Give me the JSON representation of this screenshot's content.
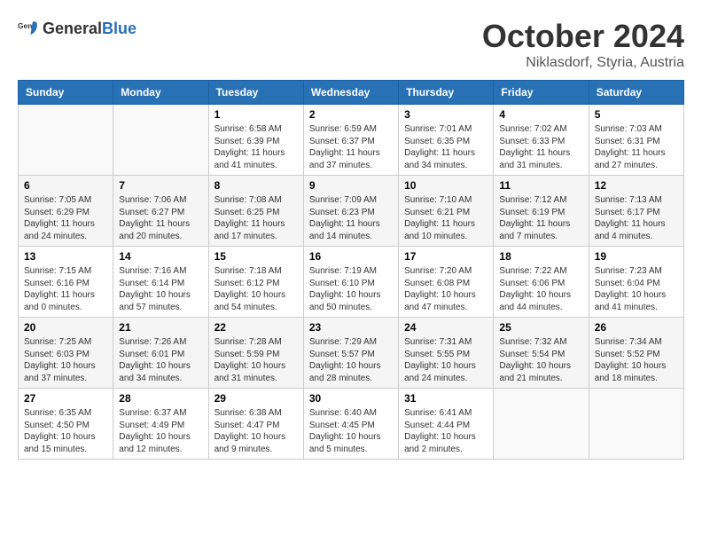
{
  "logo": {
    "text_general": "General",
    "text_blue": "Blue"
  },
  "header": {
    "month": "October 2024",
    "location": "Niklasdorf, Styria, Austria"
  },
  "weekdays": [
    "Sunday",
    "Monday",
    "Tuesday",
    "Wednesday",
    "Thursday",
    "Friday",
    "Saturday"
  ],
  "weeks": [
    [
      {
        "day": "",
        "info": ""
      },
      {
        "day": "",
        "info": ""
      },
      {
        "day": "1",
        "info": "Sunrise: 6:58 AM\nSunset: 6:39 PM\nDaylight: 11 hours\nand 41 minutes."
      },
      {
        "day": "2",
        "info": "Sunrise: 6:59 AM\nSunset: 6:37 PM\nDaylight: 11 hours\nand 37 minutes."
      },
      {
        "day": "3",
        "info": "Sunrise: 7:01 AM\nSunset: 6:35 PM\nDaylight: 11 hours\nand 34 minutes."
      },
      {
        "day": "4",
        "info": "Sunrise: 7:02 AM\nSunset: 6:33 PM\nDaylight: 11 hours\nand 31 minutes."
      },
      {
        "day": "5",
        "info": "Sunrise: 7:03 AM\nSunset: 6:31 PM\nDaylight: 11 hours\nand 27 minutes."
      }
    ],
    [
      {
        "day": "6",
        "info": "Sunrise: 7:05 AM\nSunset: 6:29 PM\nDaylight: 11 hours\nand 24 minutes."
      },
      {
        "day": "7",
        "info": "Sunrise: 7:06 AM\nSunset: 6:27 PM\nDaylight: 11 hours\nand 20 minutes."
      },
      {
        "day": "8",
        "info": "Sunrise: 7:08 AM\nSunset: 6:25 PM\nDaylight: 11 hours\nand 17 minutes."
      },
      {
        "day": "9",
        "info": "Sunrise: 7:09 AM\nSunset: 6:23 PM\nDaylight: 11 hours\nand 14 minutes."
      },
      {
        "day": "10",
        "info": "Sunrise: 7:10 AM\nSunset: 6:21 PM\nDaylight: 11 hours\nand 10 minutes."
      },
      {
        "day": "11",
        "info": "Sunrise: 7:12 AM\nSunset: 6:19 PM\nDaylight: 11 hours\nand 7 minutes."
      },
      {
        "day": "12",
        "info": "Sunrise: 7:13 AM\nSunset: 6:17 PM\nDaylight: 11 hours\nand 4 minutes."
      }
    ],
    [
      {
        "day": "13",
        "info": "Sunrise: 7:15 AM\nSunset: 6:16 PM\nDaylight: 11 hours\nand 0 minutes."
      },
      {
        "day": "14",
        "info": "Sunrise: 7:16 AM\nSunset: 6:14 PM\nDaylight: 10 hours\nand 57 minutes."
      },
      {
        "day": "15",
        "info": "Sunrise: 7:18 AM\nSunset: 6:12 PM\nDaylight: 10 hours\nand 54 minutes."
      },
      {
        "day": "16",
        "info": "Sunrise: 7:19 AM\nSunset: 6:10 PM\nDaylight: 10 hours\nand 50 minutes."
      },
      {
        "day": "17",
        "info": "Sunrise: 7:20 AM\nSunset: 6:08 PM\nDaylight: 10 hours\nand 47 minutes."
      },
      {
        "day": "18",
        "info": "Sunrise: 7:22 AM\nSunset: 6:06 PM\nDaylight: 10 hours\nand 44 minutes."
      },
      {
        "day": "19",
        "info": "Sunrise: 7:23 AM\nSunset: 6:04 PM\nDaylight: 10 hours\nand 41 minutes."
      }
    ],
    [
      {
        "day": "20",
        "info": "Sunrise: 7:25 AM\nSunset: 6:03 PM\nDaylight: 10 hours\nand 37 minutes."
      },
      {
        "day": "21",
        "info": "Sunrise: 7:26 AM\nSunset: 6:01 PM\nDaylight: 10 hours\nand 34 minutes."
      },
      {
        "day": "22",
        "info": "Sunrise: 7:28 AM\nSunset: 5:59 PM\nDaylight: 10 hours\nand 31 minutes."
      },
      {
        "day": "23",
        "info": "Sunrise: 7:29 AM\nSunset: 5:57 PM\nDaylight: 10 hours\nand 28 minutes."
      },
      {
        "day": "24",
        "info": "Sunrise: 7:31 AM\nSunset: 5:55 PM\nDaylight: 10 hours\nand 24 minutes."
      },
      {
        "day": "25",
        "info": "Sunrise: 7:32 AM\nSunset: 5:54 PM\nDaylight: 10 hours\nand 21 minutes."
      },
      {
        "day": "26",
        "info": "Sunrise: 7:34 AM\nSunset: 5:52 PM\nDaylight: 10 hours\nand 18 minutes."
      }
    ],
    [
      {
        "day": "27",
        "info": "Sunrise: 6:35 AM\nSunset: 4:50 PM\nDaylight: 10 hours\nand 15 minutes."
      },
      {
        "day": "28",
        "info": "Sunrise: 6:37 AM\nSunset: 4:49 PM\nDaylight: 10 hours\nand 12 minutes."
      },
      {
        "day": "29",
        "info": "Sunrise: 6:38 AM\nSunset: 4:47 PM\nDaylight: 10 hours\nand 9 minutes."
      },
      {
        "day": "30",
        "info": "Sunrise: 6:40 AM\nSunset: 4:45 PM\nDaylight: 10 hours\nand 5 minutes."
      },
      {
        "day": "31",
        "info": "Sunrise: 6:41 AM\nSunset: 4:44 PM\nDaylight: 10 hours\nand 2 minutes."
      },
      {
        "day": "",
        "info": ""
      },
      {
        "day": "",
        "info": ""
      }
    ]
  ]
}
